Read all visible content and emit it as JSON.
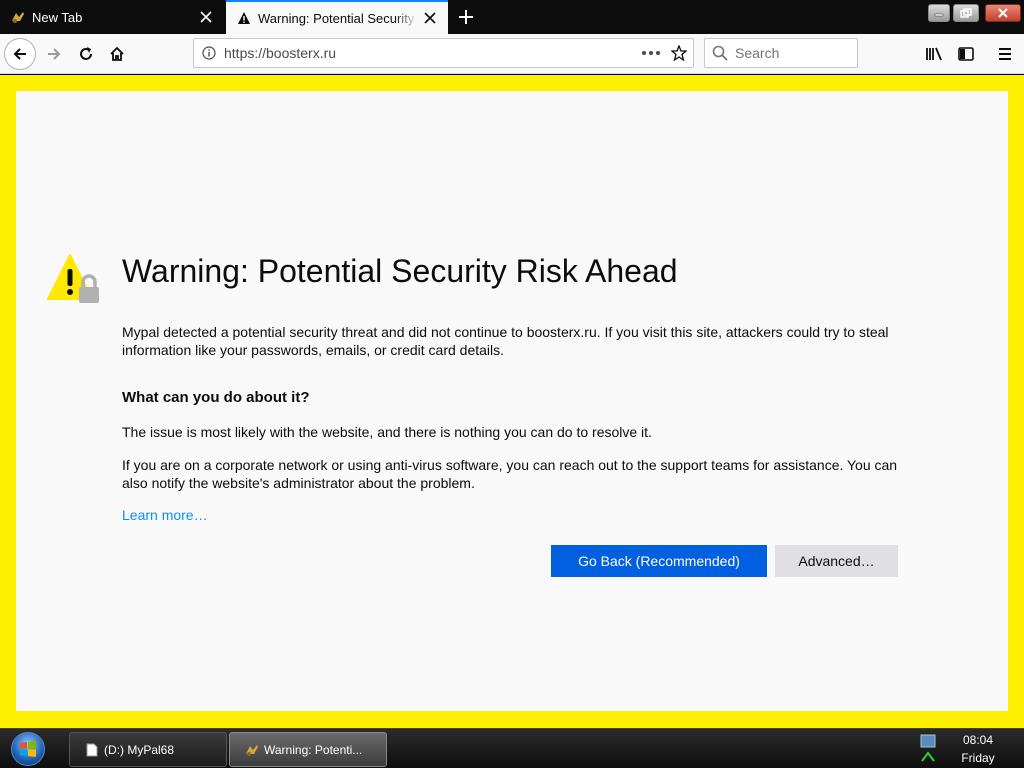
{
  "tabs": [
    {
      "title": "New Tab"
    },
    {
      "title": "Warning: Potential Security Risk Ahead"
    }
  ],
  "navbar": {
    "url": "https://boosterx.ru",
    "search_placeholder": "Search"
  },
  "page": {
    "heading": "Warning: Potential Security Risk Ahead",
    "intro": "Mypal detected a potential security threat and did not continue to boosterx.ru. If you visit this site, attackers could try to steal information like your passwords, emails, or credit card details.",
    "what_heading": "What can you do about it?",
    "para_issue": "The issue is most likely with the website, and there is nothing you can do to resolve it.",
    "para_corporate": "If you are on a corporate network or using anti-virus software, you can reach out to the support teams for assistance. You can also notify the website's administrator about the problem.",
    "learn_more": "Learn more…",
    "go_back_label": "Go Back (Recommended)",
    "advanced_label": "Advanced…"
  },
  "colors": {
    "warning_background": "#ffef00",
    "primary_button": "#0060df",
    "link": "#0a8dff"
  },
  "taskbar": {
    "items": [
      {
        "label": "(D:) MyPal68"
      },
      {
        "label": "Warning: Potenti..."
      }
    ],
    "clock_time": "08:04",
    "clock_day": "Friday"
  }
}
